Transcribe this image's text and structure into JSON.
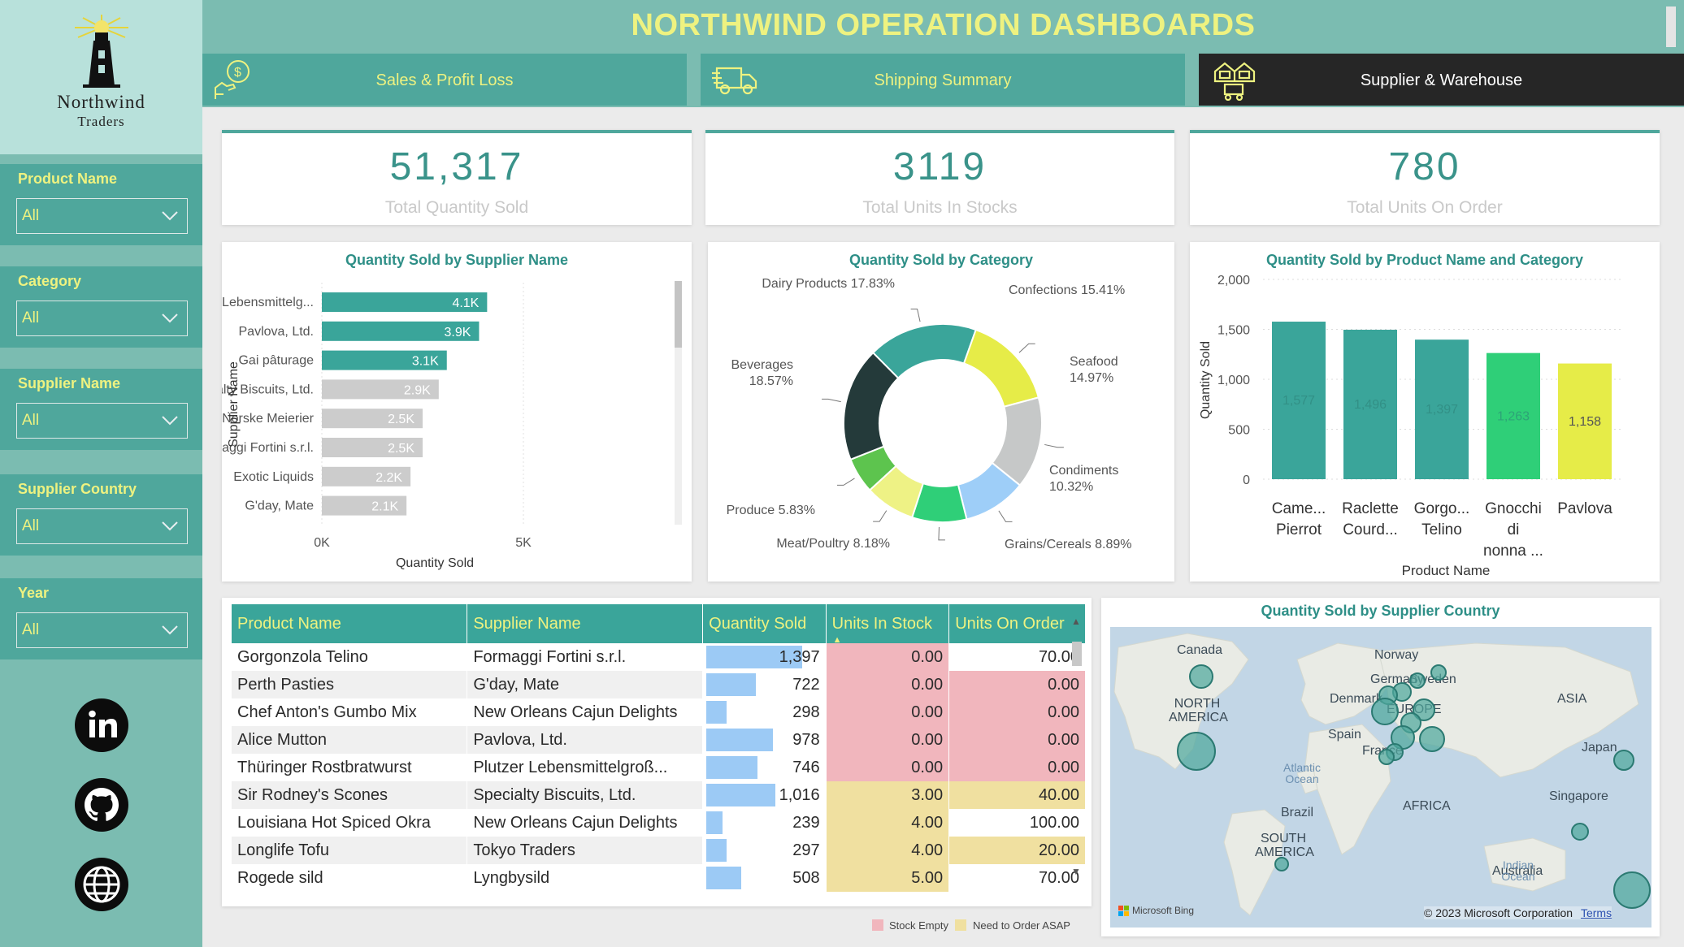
{
  "brand": {
    "name_line1": "Northwind",
    "name_line2": "Traders"
  },
  "title": "NORTHWIND OPERATION DASHBOARDS",
  "tabs": [
    {
      "label": "Sales & Profit Loss",
      "icon": "money-hand-icon"
    },
    {
      "label": "Shipping Summary",
      "icon": "truck-icon"
    },
    {
      "label": "Supplier & Warehouse",
      "icon": "warehouse-icon"
    }
  ],
  "slicers": [
    {
      "label": "Product Name",
      "value": "All"
    },
    {
      "label": "Category",
      "value": "All"
    },
    {
      "label": "Supplier Name",
      "value": "All"
    },
    {
      "label": "Supplier Country",
      "value": "All"
    },
    {
      "label": "Year",
      "value": "All"
    }
  ],
  "social": [
    {
      "icon": "linkedin-icon"
    },
    {
      "icon": "github-icon"
    },
    {
      "icon": "globe-icon"
    }
  ],
  "kpis": [
    {
      "value": "51,317",
      "label": "Total Quantity Sold"
    },
    {
      "value": "3119",
      "label": "Total Units In Stocks"
    },
    {
      "value": "780",
      "label": "Total Units On Order"
    }
  ],
  "colors": {
    "teal": "#3aa59a",
    "grey_bar": "#cccccc",
    "yellow": "#eef280",
    "dark_tab": "#262626"
  },
  "chart_data": [
    {
      "type": "bar",
      "orientation": "horizontal",
      "title": "Quantity Sold by Supplier Name",
      "xlabel": "Quantity Sold",
      "ylabel": "Supplier Name",
      "xlim": [
        0,
        5000
      ],
      "xticks": [
        "0K",
        "5K"
      ],
      "categories": [
        "Plutzer Lebensmittelg...",
        "Pavlova, Ltd.",
        "Gai pâturage",
        "Specialty Biscuits, Ltd.",
        "Norske Meierier",
        "Formaggi Fortini s.r.l.",
        "Exotic Liquids",
        "G'day, Mate"
      ],
      "values": [
        4100,
        3900,
        3100,
        2900,
        2500,
        2500,
        2200,
        2100
      ],
      "data_labels": [
        "4.1K",
        "3.9K",
        "3.1K",
        "2.9K",
        "2.5K",
        "2.5K",
        "2.2K",
        "2.1K"
      ],
      "bar_colors": [
        "#3aa59a",
        "#3aa59a",
        "#3aa59a",
        "#cccccc",
        "#cccccc",
        "#cccccc",
        "#cccccc",
        "#cccccc"
      ]
    },
    {
      "type": "pie",
      "donut": true,
      "title": "Quantity Sold by Category",
      "slices": [
        {
          "label": "Dairy Products",
          "pct": "17.83%",
          "value": 17.83,
          "color": "#3aa59a"
        },
        {
          "label": "Confections",
          "pct": "15.41%",
          "value": 15.41,
          "color": "#e6ec48"
        },
        {
          "label": "Seafood",
          "pct": "14.97%",
          "value": 14.97,
          "color": "#c6c8c8"
        },
        {
          "label": "Condiments",
          "pct": "10.32%",
          "value": 10.32,
          "color": "#9ecef8"
        },
        {
          "label": "Grains/Cereals",
          "pct": "8.89%",
          "value": 8.89,
          "color": "#2fcf78"
        },
        {
          "label": "Meat/Poultry",
          "pct": "8.18%",
          "value": 8.18,
          "color": "#eef285"
        },
        {
          "label": "Produce",
          "pct": "5.83%",
          "value": 5.83,
          "color": "#5dc44e"
        },
        {
          "label": "Beverages",
          "pct": "18.57%",
          "value": 18.57,
          "color": "#243a3a"
        }
      ]
    },
    {
      "type": "bar",
      "title": "Quantity Sold by Product Name and Category",
      "xlabel": "Product Name",
      "ylabel": "Quantity Sold",
      "ylim": [
        0,
        2000
      ],
      "yticks": [
        "0",
        "500",
        "1,000",
        "1,500",
        "2,000"
      ],
      "categories": [
        [
          "Came...",
          "Pierrot"
        ],
        [
          "Raclette",
          "Courd..."
        ],
        [
          "Gorgo...",
          "Telino"
        ],
        [
          "Gnocchi",
          "di",
          "nonna ..."
        ],
        [
          "Pavlova"
        ]
      ],
      "values": [
        1577,
        1496,
        1397,
        1263,
        1158
      ],
      "data_labels": [
        "1,577",
        "1,496",
        "1,397",
        "1,263",
        "1,158"
      ],
      "bar_colors": [
        "#3aa59a",
        "#3aa59a",
        "#3aa59a",
        "#2fcf78",
        "#e6ec48"
      ]
    }
  ],
  "table": {
    "columns": [
      "Product Name",
      "Supplier Name",
      "Quantity Sold",
      "Units In Stock",
      "Units On Order"
    ],
    "sort_indicator": "▲",
    "max_qty": 1577,
    "rows": [
      {
        "product": "Gorgonzola Telino",
        "supplier": "Formaggi Fortini s.r.l.",
        "qty": "1,397",
        "qty_num": 1397,
        "stock": "0.00",
        "order": "70.00",
        "stock_color": "#f1b6bd",
        "order_color": "#ffffff"
      },
      {
        "product": "Perth Pasties",
        "supplier": "G'day, Mate",
        "qty": "722",
        "qty_num": 722,
        "stock": "0.00",
        "order": "0.00",
        "stock_color": "#f1b6bd",
        "order_color": "#f1b6bd"
      },
      {
        "product": "Chef Anton's Gumbo Mix",
        "supplier": "New Orleans Cajun Delights",
        "qty": "298",
        "qty_num": 298,
        "stock": "0.00",
        "order": "0.00",
        "stock_color": "#f1b6bd",
        "order_color": "#f1b6bd"
      },
      {
        "product": "Alice Mutton",
        "supplier": "Pavlova, Ltd.",
        "qty": "978",
        "qty_num": 978,
        "stock": "0.00",
        "order": "0.00",
        "stock_color": "#f1b6bd",
        "order_color": "#f1b6bd"
      },
      {
        "product": "Thüringer Rostbratwurst",
        "supplier": "Plutzer Lebensmittelgroß...",
        "qty": "746",
        "qty_num": 746,
        "stock": "0.00",
        "order": "0.00",
        "stock_color": "#f1b6bd",
        "order_color": "#f1b6bd"
      },
      {
        "product": "Sir Rodney's Scones",
        "supplier": "Specialty Biscuits, Ltd.",
        "qty": "1,016",
        "qty_num": 1016,
        "stock": "3.00",
        "order": "40.00",
        "stock_color": "#f0e0a0",
        "order_color": "#f0e0a0"
      },
      {
        "product": "Louisiana Hot Spiced Okra",
        "supplier": "New Orleans Cajun Delights",
        "qty": "239",
        "qty_num": 239,
        "stock": "4.00",
        "order": "100.00",
        "stock_color": "#f0e0a0",
        "order_color": "#ffffff"
      },
      {
        "product": "Longlife Tofu",
        "supplier": "Tokyo Traders",
        "qty": "297",
        "qty_num": 297,
        "stock": "4.00",
        "order": "20.00",
        "stock_color": "#f0e0a0",
        "order_color": "#f0e0a0"
      },
      {
        "product": "Rogede sild",
        "supplier": "Lyngbysild",
        "qty": "508",
        "qty_num": 508,
        "stock": "5.00",
        "order": "70.00",
        "stock_color": "#f0e0a0",
        "order_color": "#ffffff"
      }
    ]
  },
  "legend": [
    {
      "label": "Stock Empty",
      "color": "#f1b6bd"
    },
    {
      "label": "Need to Order ASAP",
      "color": "#f0e0a0"
    }
  ],
  "map": {
    "title": "Quantity Sold by Supplier Country",
    "labels": [
      "Canada",
      "NORTH AMERICA",
      "Norway",
      "Sweden",
      "Germany",
      "Denmark",
      "EUROPE",
      "ASIA",
      "Spain",
      "France",
      "Japan",
      "Singapore",
      "AFRICA",
      "Brazil",
      "SOUTH AMERICA",
      "Australia"
    ],
    "ocean_labels": [
      "Atlantic Ocean",
      "Indian Ocean"
    ],
    "attribution": "Microsoft Bing",
    "copyright": "© 2023 Microsoft Corporation",
    "terms": "Terms"
  }
}
